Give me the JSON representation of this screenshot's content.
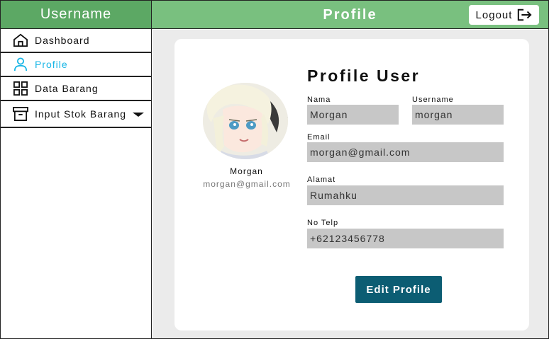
{
  "sidebar": {
    "header": "Username",
    "items": [
      {
        "label": "Dashboard",
        "icon": "home-icon"
      },
      {
        "label": "Profile",
        "icon": "user-icon"
      },
      {
        "label": "Data Barang",
        "icon": "grid-icon"
      },
      {
        "label": "Input Stok Barang",
        "icon": "archive-icon"
      }
    ]
  },
  "topbar": {
    "title": "Profile",
    "logout_label": "Logout"
  },
  "profile": {
    "name": "Morgan",
    "email": "morgan@gmail.com"
  },
  "form": {
    "title": "Profile User",
    "nama_label": "Nama",
    "nama_value": "Morgan",
    "username_label": "Username",
    "username_value": "morgan",
    "email_label": "Email",
    "email_value": "morgan@gmail.com",
    "alamat_label": "Alamat",
    "alamat_value": "Rumahku",
    "telp_label": "No Telp",
    "telp_value": "+62123456778",
    "edit_label": "Edit Profile"
  },
  "colors": {
    "sidebar_header": "#5ca864",
    "topbar": "#79c07f",
    "active": "#19b6e6",
    "button": "#0c5d73",
    "field": "#c7c7c7"
  }
}
